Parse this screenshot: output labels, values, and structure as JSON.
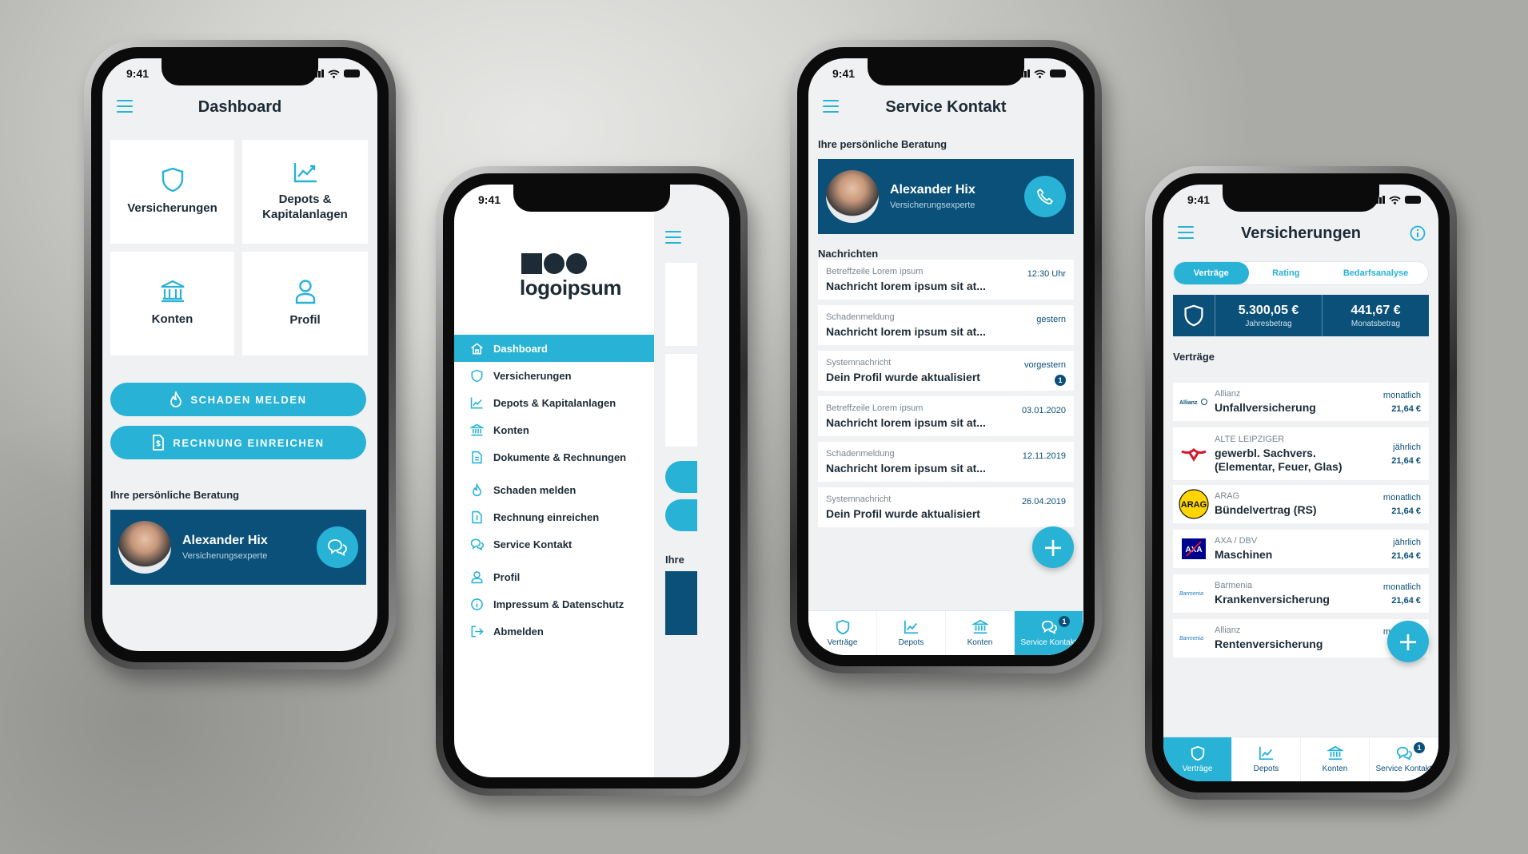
{
  "colors": {
    "primary": "#27b2d6",
    "navy": "#0b5079",
    "text": "#1d2b36"
  },
  "status_time": "9:41",
  "dashboard": {
    "title": "Dashboard",
    "tiles": [
      {
        "label": "Versicherungen",
        "icon": "shield-icon"
      },
      {
        "label": "Depots & Kapitalanlagen",
        "icon": "chart-icon"
      },
      {
        "label": "Konten",
        "icon": "bank-icon"
      },
      {
        "label": "Profil",
        "icon": "user-icon"
      }
    ],
    "damage_button": "SCHADEN MELDEN",
    "invoice_button": "RECHNUNG EINREICHEN",
    "advice_heading": "Ihre persönliche Beratung",
    "advisor": {
      "name": "Alexander Hix",
      "role": "Versicherungsexperte"
    }
  },
  "menu": {
    "logo_text": "logoipsum",
    "items": [
      {
        "label": "Dashboard",
        "icon": "home-icon",
        "active": true
      },
      {
        "label": "Versicherungen",
        "icon": "shield-icon"
      },
      {
        "label": "Depots & Kapitalanlagen",
        "icon": "chart-icon"
      },
      {
        "label": "Konten",
        "icon": "bank-icon"
      },
      {
        "label": "Dokumente & Rechnungen",
        "icon": "document-icon"
      },
      {
        "label": "Schaden melden",
        "icon": "flame-icon"
      },
      {
        "label": "Rechnung einreichen",
        "icon": "invoice-icon"
      },
      {
        "label": "Service Kontakt",
        "icon": "chat-icon"
      },
      {
        "label": "Profil",
        "icon": "user-icon"
      },
      {
        "label": "Impressum & Datenschutz",
        "icon": "info-icon"
      },
      {
        "label": "Abmelden",
        "icon": "logout-icon"
      }
    ],
    "peek_text": "Ihre"
  },
  "service": {
    "title": "Service Kontakt",
    "advice_heading": "Ihre persönliche Beratung",
    "advisor": {
      "name": "Alexander Hix",
      "role": "Versicherungsexperte"
    },
    "messages_heading": "Nachrichten",
    "messages": [
      {
        "subject": "Betreffzeile Lorem ipsum",
        "text": "Nachricht lorem ipsum sit at...",
        "date": "12:30 Uhr"
      },
      {
        "subject": "Schadenmeldung",
        "text": "Nachricht lorem ipsum sit at...",
        "date": "gestern"
      },
      {
        "subject": "Systemnachricht",
        "text": "Dein Profil wurde aktualisiert",
        "date": "vorgestern",
        "badge": "1"
      },
      {
        "subject": "Betreffzeile Lorem ipsum",
        "text": "Nachricht lorem ipsum sit at...",
        "date": "03.01.2020"
      },
      {
        "subject": "Schadenmeldung",
        "text": "Nachricht lorem ipsum sit at...",
        "date": "12.11.2019"
      },
      {
        "subject": "Systemnachricht",
        "text": "Dein Profil wurde aktualisiert",
        "date": "26.04.2019"
      }
    ],
    "tabs": [
      "Verträge",
      "Depots",
      "Konten",
      "Service Kontakt"
    ],
    "tab_badge": "1"
  },
  "insurances": {
    "title": "Versicherungen",
    "segments": [
      "Verträge",
      "Rating",
      "Bedarfsanalyse"
    ],
    "yearly_amount": "5.300,05 €",
    "yearly_label": "Jahresbetrag",
    "monthly_amount": "441,67 €",
    "monthly_label": "Monatsbetrag",
    "contracts_heading": "Verträge",
    "contracts": [
      {
        "company": "Allianz",
        "name": "Unfallversicherung",
        "interval": "monatlich",
        "price": "21,64 €",
        "logo": "Allianz"
      },
      {
        "company": "ALTE LEIPZIGER",
        "name": "gewerbl. Sachvers. (Elementar, Feuer, Glas)",
        "interval": "jährlich",
        "price": "21,64 €",
        "logo": "alte-leipziger"
      },
      {
        "company": "ARAG",
        "name": "Bündelvertrag (RS)",
        "interval": "monatlich",
        "price": "21,64 €",
        "logo": "ARAG"
      },
      {
        "company": "AXA / DBV",
        "name": "Maschinen",
        "interval": "jährlich",
        "price": "21,64 €",
        "logo": "AXA"
      },
      {
        "company": "Barmenia",
        "name": "Krankenversicherung",
        "interval": "monatlich",
        "price": "21,64 €",
        "logo": "Barmenia"
      },
      {
        "company": "Allianz",
        "name": "Rentenversicherung",
        "interval": "monatlich",
        "price": "",
        "logo": "Barmenia"
      }
    ],
    "tabs": [
      "Verträge",
      "Depots",
      "Konten",
      "Service Kontakt"
    ],
    "tab_badge": "1"
  }
}
